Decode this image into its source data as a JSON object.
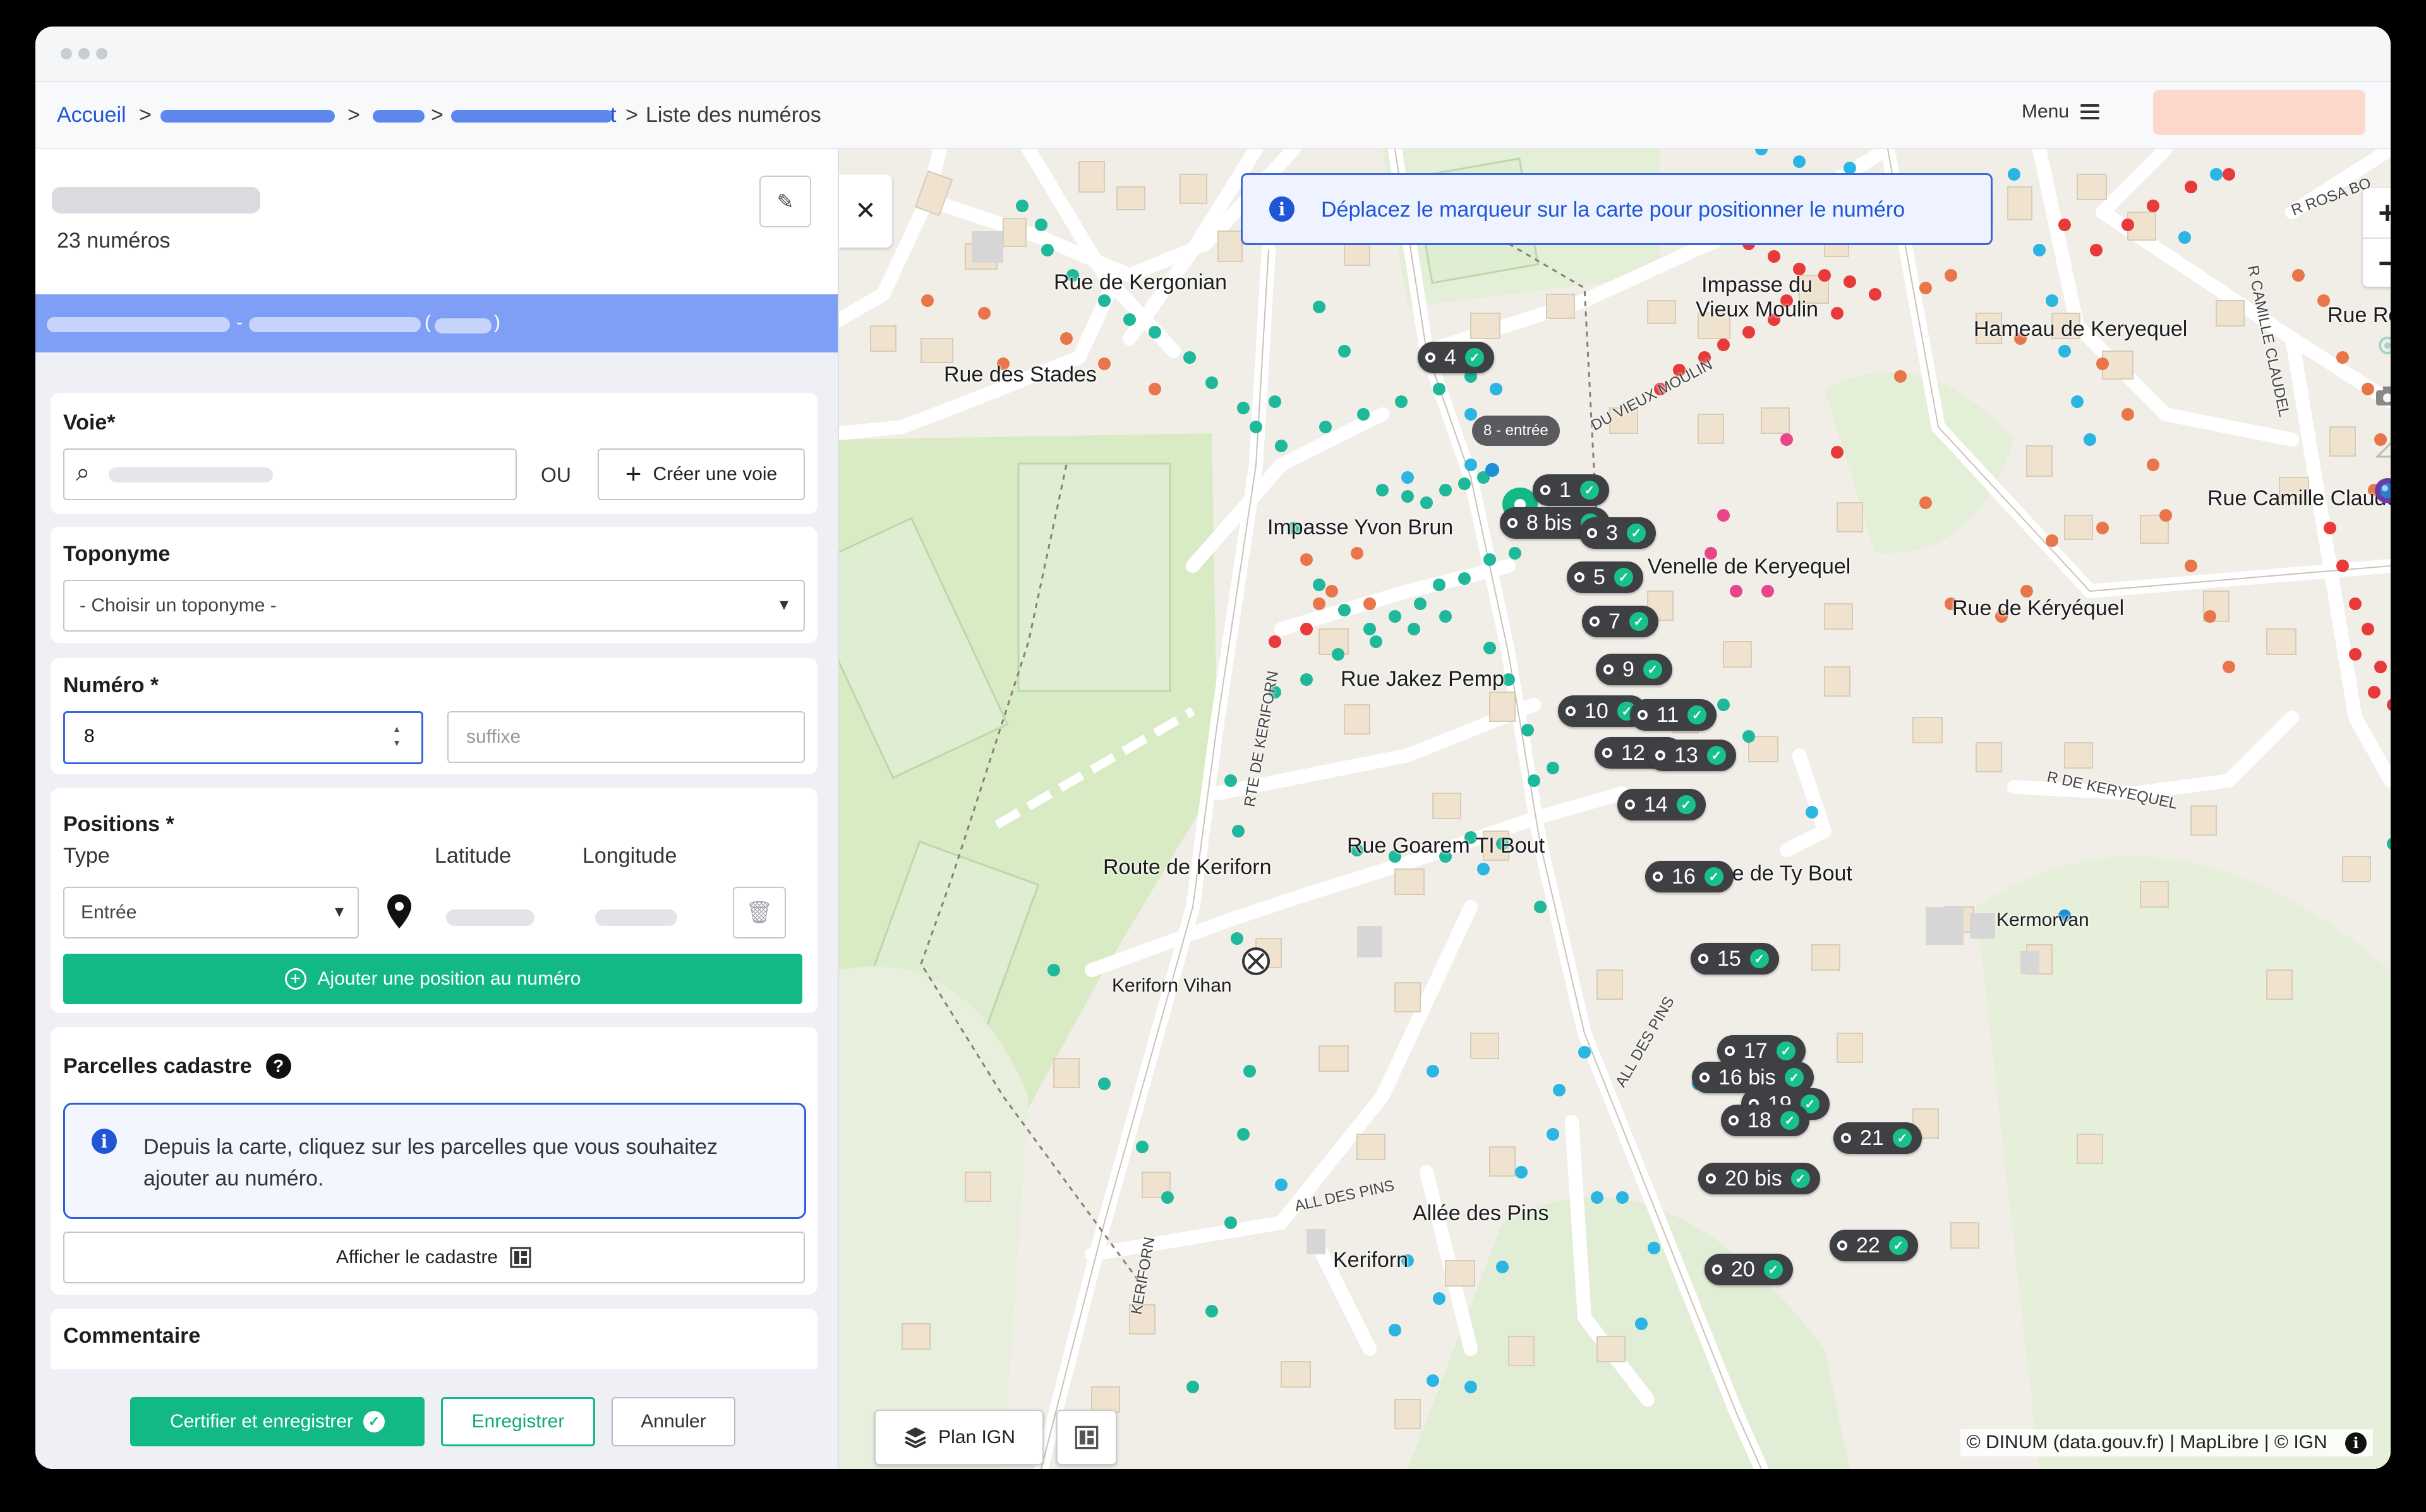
{
  "header": {
    "breadcrumb_home": "Accueil",
    "separator": ">",
    "breadcrumb_tail": "t",
    "breadcrumb_current": "Liste des numéros",
    "menu_label": "Menu"
  },
  "sidebar": {
    "count_text": "23 numéros",
    "band_sep": "-",
    "band_paren_open": "(",
    "band_paren_close": ")",
    "voie": {
      "title": "Voie*",
      "or_label": "OU",
      "create_label": "Créer une voie"
    },
    "toponyme": {
      "title": "Toponyme",
      "placeholder": "- Choisir un toponyme -"
    },
    "numero": {
      "title": "Numéro *",
      "value": "8",
      "suffix_placeholder": "suffixe"
    },
    "positions": {
      "title": "Positions *",
      "col_type": "Type",
      "col_lat": "Latitude",
      "col_lng": "Longitude",
      "type_value": "Entrée",
      "add_label": "Ajouter une position au numéro"
    },
    "parcelles": {
      "title": "Parcelles cadastre",
      "info_text": "Depuis la carte, cliquez sur les parcelles que vous souhaitez ajouter au numéro.",
      "show_label": "Afficher le cadastre"
    },
    "commentaire": {
      "title": "Commentaire"
    },
    "footer": {
      "certify_label": "Certifier et enregistrer",
      "save_label": "Enregistrer",
      "cancel_label": "Annuler"
    }
  },
  "map": {
    "banner_text": "Déplacez le marqueur sur la carte pour positionner le numéro",
    "plan_label": "Plan IGN",
    "attribution": "© DINUM (data.gouv.fr) | MapLibre | © IGN",
    "tooltip": "8 - entrée",
    "labels": {
      "rue_kergonian": "Rue de Kergonian",
      "rue_stades": "Rue des Stades",
      "impasse_vieux_moulin": "Impasse du\nVieux Moulin",
      "hameau_keryequel": "Hameau de Keryequel",
      "rue_rosa": "Rue Rosa",
      "rue_camille": "Rue Camille Claudel",
      "impasse_yvon": "Impasse Yvon Brun",
      "venelle": "Venelle de Keryequel",
      "rue_keryequel": "Rue de Kéryéquel",
      "rue_jakez": "Rue Jakez Pemp",
      "rue_goarem": "Rue Goarem TI Bout",
      "route_keriforn": "Route de Keriforn",
      "impasse_ty_bout": "Impasse de Ty Bout",
      "kermorvan": "Kermorvan",
      "keriforn_vihan": "Keriforn Vihan",
      "allee_pins": "Allée des Pins",
      "keriforn": "Keriforn",
      "r_keryequel_small": "R DE KERYEQUEL",
      "all_des_pins_small": "ALL DES PINS",
      "rte_keriforn_small": "RTE DE KERIFORN",
      "vieux_moulin_small": "DU VIEUX MOULIN",
      "r_rosa_small": "R ROSA BO",
      "keriforn_small": "KERIFORN",
      "camille_small": "R CAMILLE CLAUDEL"
    },
    "markers": [
      "4",
      "1",
      "8 bis",
      "3",
      "5",
      "7",
      "9",
      "10",
      "11",
      "12",
      "13",
      "14",
      "16",
      "15",
      "17",
      "16 bis",
      "19",
      "18",
      "21",
      "20 bis",
      "22",
      "20"
    ],
    "icons": {
      "zoom_in": "+",
      "zoom_out": "−",
      "close": "✕",
      "info": "i",
      "check": "✓",
      "edit": "✎",
      "search": "⌕",
      "plus": "+",
      "chevron": "▾",
      "spin_up": "▲",
      "spin_down": "▼",
      "help": "?",
      "trash": "🗑",
      "target": "⊗"
    }
  }
}
